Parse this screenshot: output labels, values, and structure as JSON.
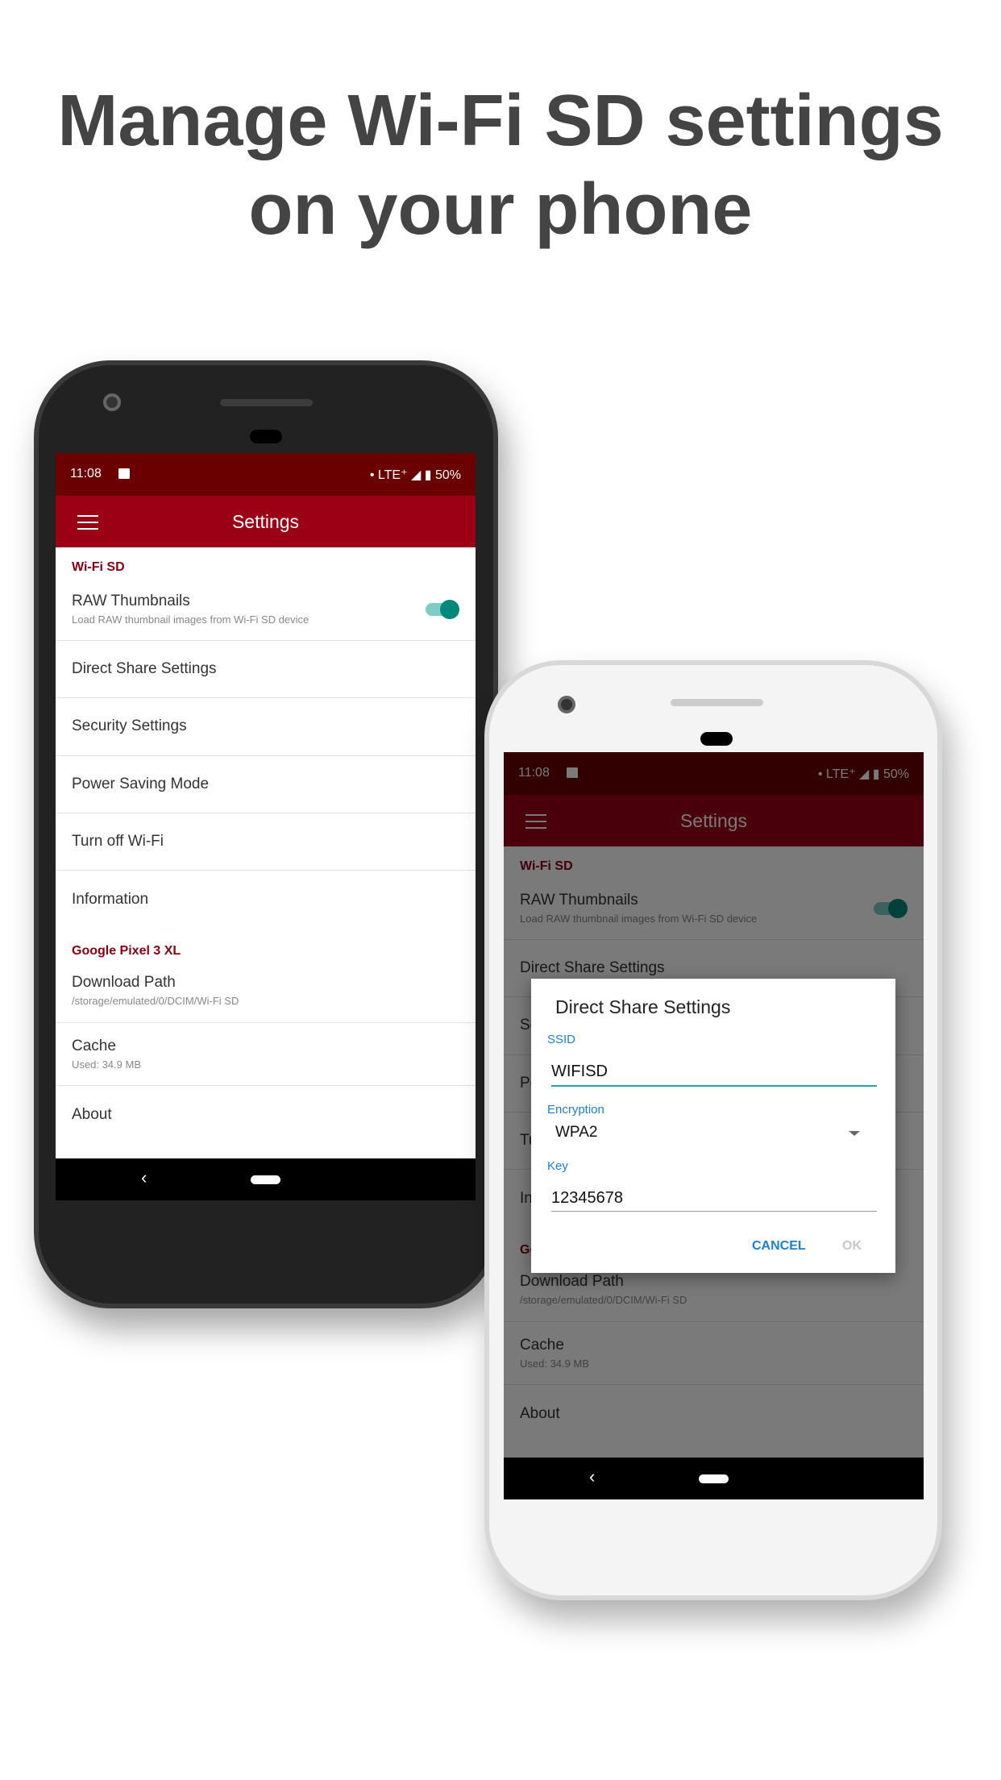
{
  "headline": {
    "line1": "Manage Wi-Fi SD settings",
    "line2": "on your phone"
  },
  "status": {
    "time": "11:08",
    "right": "• LTE⁺ ◢ ▮ 50%"
  },
  "appbar": {
    "title": "Settings"
  },
  "settings": {
    "section_wifi": "Wi-Fi SD",
    "raw_title": "RAW Thumbnails",
    "raw_subtitle": "Load RAW thumbnail images from Wi-Fi SD device",
    "raw_enabled": true,
    "items": [
      "Direct Share Settings",
      "Security Settings",
      "Power Saving Mode",
      "Turn off Wi-Fi",
      "Information"
    ],
    "section_device": "Google Pixel 3 XL",
    "download_title": "Download Path",
    "download_subtitle": "/storage/emulated/0/DCIM/Wi-Fi SD",
    "cache_title": "Cache",
    "cache_subtitle": "Used: 34.9 MB",
    "about": "About"
  },
  "nav": {
    "back": "‹"
  },
  "dialog": {
    "title": "Direct Share Settings",
    "ssid_label": "SSID",
    "ssid_value": "WIFISD",
    "encryption_label": "Encryption",
    "encryption_value": "WPA2",
    "key_label": "Key",
    "key_value": "12345678",
    "cancel": "CANCEL",
    "ok": "OK"
  },
  "colors": {
    "accent": "#9b0015",
    "status_bar": "#6a0000",
    "toggle": "#00897b",
    "dialog_link": "#1e7fd0",
    "field_focus": "#26a69a"
  }
}
